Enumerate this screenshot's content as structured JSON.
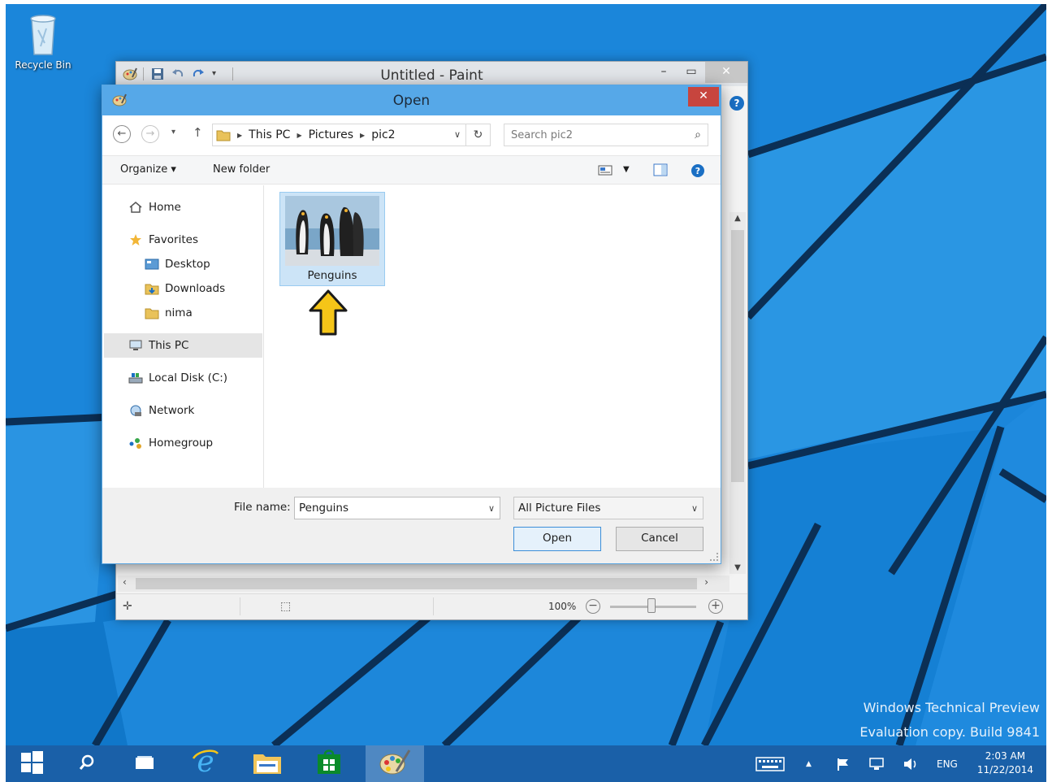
{
  "desktop": {
    "recycle_bin_label": "Recycle Bin",
    "watermark_line1": "Windows Technical Preview",
    "watermark_line2": "Evaluation copy. Build 9841"
  },
  "paint": {
    "title": "Untitled - Paint",
    "zoom": "100%",
    "minimize_glyph": "–",
    "maximize_glyph": "▭",
    "close_glyph": "✕",
    "help_glyph": "?"
  },
  "dialog": {
    "title": "Open",
    "close_glyph": "✕",
    "breadcrumbs": [
      "This PC",
      "Pictures",
      "pic2"
    ],
    "search_placeholder": "Search pic2",
    "toolbar": {
      "organize_label": "Organize ▾",
      "new_folder_label": "New folder"
    },
    "nav": {
      "home": "Home",
      "favorites": "Favorites",
      "desktop": "Desktop",
      "downloads": "Downloads",
      "nima": "nima",
      "this_pc": "This PC",
      "local_disk": "Local Disk (C:)",
      "network": "Network",
      "homegroup": "Homegroup"
    },
    "files": [
      {
        "name": "Penguins"
      }
    ],
    "file_name_label": "File name:",
    "file_name_value": "Penguins",
    "file_type": "All Picture Files",
    "open_label": "Open",
    "cancel_label": "Cancel"
  },
  "taskbar": {
    "language": "ENG",
    "time": "2:03 AM",
    "date": "11/22/2014"
  },
  "colors": {
    "desktop_blue": "#1b86da",
    "taskbar": "#1a60a8",
    "dialog_title": "#56a8e8",
    "close_red": "#c7453e",
    "selection": "#cce4f7",
    "arrow_yellow": "#f5c518"
  }
}
